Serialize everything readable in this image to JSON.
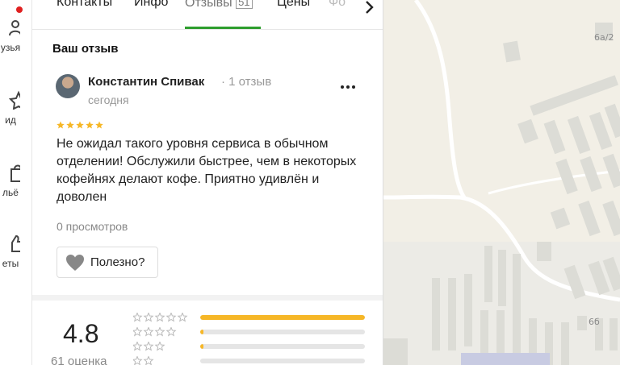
{
  "rail": {
    "items": [
      {
        "label": "узья",
        "icon": "friends-icon"
      },
      {
        "label": "ид",
        "icon": "star-icon"
      },
      {
        "label": "льё",
        "icon": "bag-icon"
      },
      {
        "label": "еты",
        "icon": "thumbs-up-icon"
      }
    ],
    "notification_color": "#e02020"
  },
  "tabs": {
    "items": [
      "Контакты",
      "Инфо",
      "Отзывы",
      "Цены",
      "Фо"
    ],
    "reviews_count": "51",
    "active": "Отзывы",
    "accent_color": "#2e9e2e"
  },
  "review": {
    "section_title": "Ваш отзыв",
    "author": "Константин Спивак",
    "author_meta": "· 1 отзыв",
    "date": "сегодня",
    "stars": 5,
    "text": "Не ожидал такого уровня сервиса в обычном отделении! Обслужили быстрее, чем в некоторых кофейнях делают кофе. Приятно удивлён и доволен",
    "views": "0 просмотров",
    "useful_label": "Полезно?"
  },
  "rating": {
    "value": "4.8",
    "count_label": "61 оценка",
    "star_color": "#f6b727",
    "distribution": [
      {
        "stars": 5,
        "fraction": 1.0
      },
      {
        "stars": 4,
        "fraction": 0.02
      },
      {
        "stars": 3,
        "fraction": 0.02
      },
      {
        "stars": 2,
        "fraction": 0.0
      }
    ]
  },
  "map": {
    "labels": [
      "6а/2",
      "6б"
    ]
  }
}
